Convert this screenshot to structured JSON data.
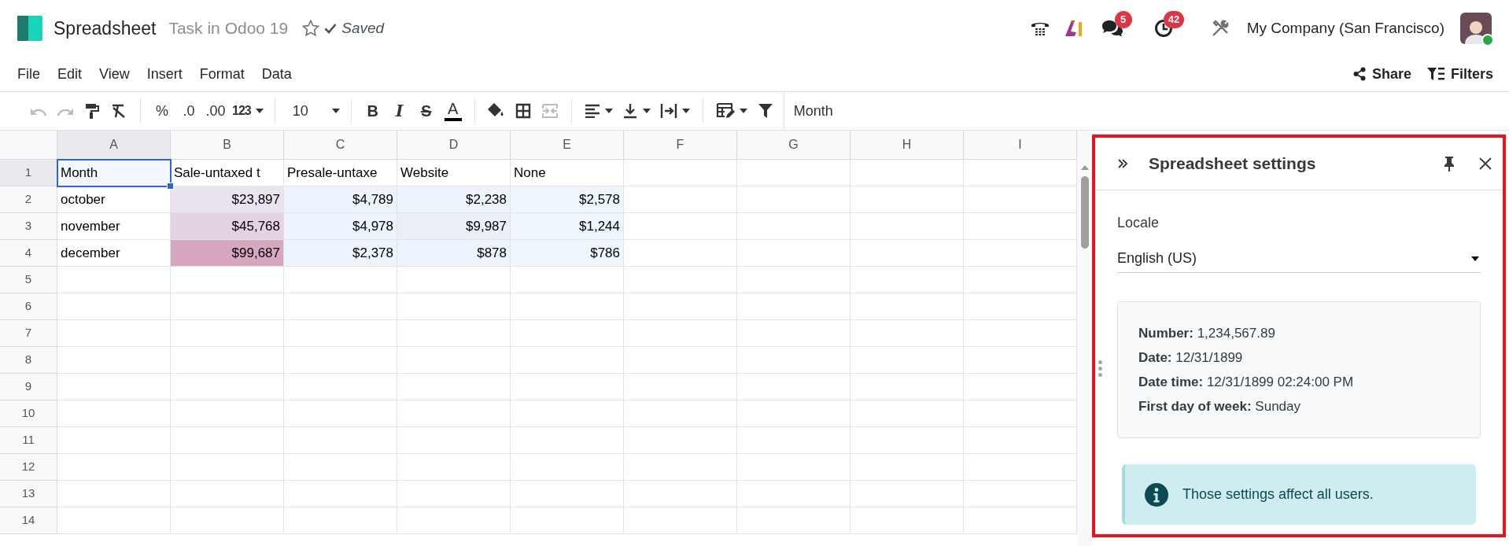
{
  "app": {
    "name": "Spreadsheet",
    "record": "Task in Odoo 19",
    "favorite": false,
    "status": "Saved"
  },
  "systray": {
    "messages_badge": "5",
    "activities_badge": "42",
    "company": "My Company (San Francisco)",
    "avatar_online": true
  },
  "menu": [
    "File",
    "Edit",
    "View",
    "Insert",
    "Format",
    "Data"
  ],
  "actions": [
    "Share",
    "Filters"
  ],
  "toolbar": {
    "undo_disabled": true,
    "redo_disabled": true,
    "merge_disabled": true,
    "percent": "%",
    "decrease_decimals": ".0",
    "increase_decimals": ".00",
    "more_formats": "123",
    "font_size": "10",
    "bold": "B",
    "italic": "I",
    "strikethrough": "S",
    "text_color": "A"
  },
  "formula_bar": "Month",
  "grid": {
    "columns": [
      {
        "label": "A",
        "selected": true
      },
      {
        "label": "B",
        "selected": false
      },
      {
        "label": "C",
        "selected": false
      },
      {
        "label": "D",
        "selected": false
      },
      {
        "label": "E",
        "selected": false
      },
      {
        "label": "F",
        "selected": false
      },
      {
        "label": "G",
        "selected": false
      },
      {
        "label": "H",
        "selected": false
      },
      {
        "label": "I",
        "selected": false
      }
    ],
    "rows": [
      {
        "label": "1",
        "selected": true,
        "cells": [
          {
            "value": "Month",
            "kind": "text",
            "selected": true
          },
          {
            "value": "Sale-untaxed t",
            "kind": "text",
            "selected": false
          },
          {
            "value": "Presale-untaxe",
            "kind": "text",
            "selected": false
          },
          {
            "value": "Website",
            "kind": "text",
            "selected": false
          },
          {
            "value": "None",
            "kind": "text",
            "selected": false
          }
        ]
      },
      {
        "label": "2",
        "selected": false,
        "cells": [
          {
            "value": "october",
            "kind": "text",
            "selected": false
          },
          {
            "value": "$23,897",
            "kind": "number",
            "color": "#ebe3ee",
            "selected": false
          },
          {
            "value": "$4,789",
            "kind": "number",
            "color": "#eef4fd",
            "selected": false
          },
          {
            "value": "$2,238",
            "kind": "number",
            "color": "#eef4fd",
            "selected": false
          },
          {
            "value": "$2,578",
            "kind": "number",
            "color": "#eef5fd",
            "selected": false
          }
        ]
      },
      {
        "label": "3",
        "selected": false,
        "cells": [
          {
            "value": "november",
            "kind": "text",
            "selected": false
          },
          {
            "value": "$45,768",
            "kind": "number",
            "color": "#e4d3e2",
            "selected": false
          },
          {
            "value": "$4,978",
            "kind": "number",
            "color": "#eef4fd",
            "selected": false
          },
          {
            "value": "$9,987",
            "kind": "number",
            "color": "#eceef7",
            "selected": false
          },
          {
            "value": "$1,244",
            "kind": "number",
            "color": "#eef5fd",
            "selected": false
          }
        ]
      },
      {
        "label": "4",
        "selected": false,
        "cells": [
          {
            "value": "december",
            "kind": "text",
            "selected": false
          },
          {
            "value": "$99,687",
            "kind": "number",
            "color": "#d6a7be",
            "selected": false
          },
          {
            "value": "$2,378",
            "kind": "number",
            "color": "#eef4fd",
            "selected": false
          },
          {
            "value": "$878",
            "kind": "number",
            "color": "#eef4fd",
            "selected": false
          },
          {
            "value": "$786",
            "kind": "number",
            "color": "#eef5fd",
            "selected": false
          }
        ]
      },
      {
        "label": "5",
        "selected": false
      },
      {
        "label": "6",
        "selected": false
      },
      {
        "label": "7",
        "selected": false
      },
      {
        "label": "8",
        "selected": false
      },
      {
        "label": "9",
        "selected": false
      },
      {
        "label": "10",
        "selected": false
      },
      {
        "label": "11",
        "selected": false
      },
      {
        "label": "12",
        "selected": false
      },
      {
        "label": "13",
        "selected": false
      },
      {
        "label": "14",
        "selected": false
      }
    ]
  },
  "panel": {
    "highlighted": true,
    "title": "Spreadsheet settings",
    "locale_label": "Locale",
    "locale": "English (US)",
    "formats": [
      "**Number:** 1,234,567.89",
      "**Date:** 12/31/1899",
      "**Date time:** 12/31/1899 02:24:00 PM",
      "**First day of week:** Sunday"
    ],
    "notice": "Those settings affect all users."
  }
}
